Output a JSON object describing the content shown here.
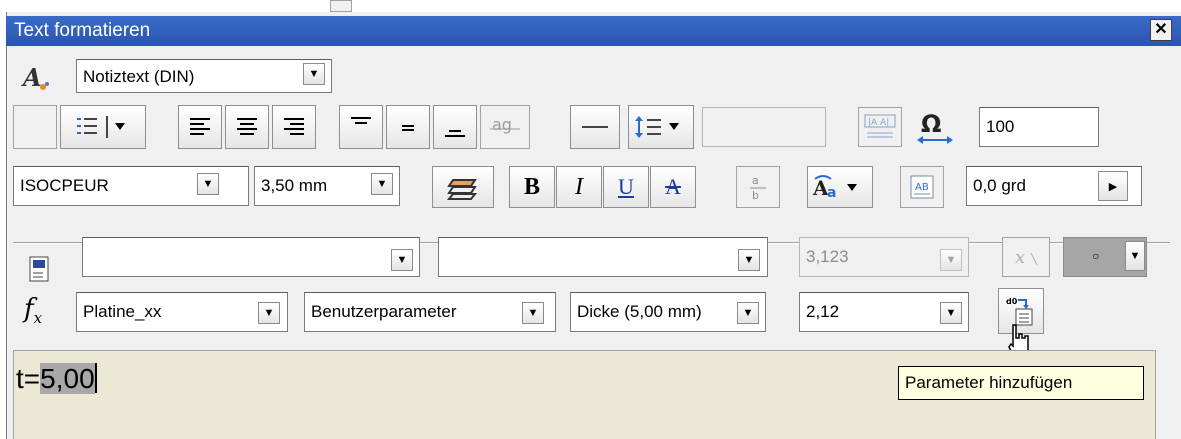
{
  "window": {
    "title": "Text formatieren",
    "close_label": "✕"
  },
  "row1": {
    "style_dropdown": {
      "value": "Notiztext (DIN)"
    }
  },
  "row2": {
    "width_scale_value": "100"
  },
  "row3": {
    "font_dropdown": {
      "value": "ISOCPEUR"
    },
    "size_dropdown": {
      "value": "3,50 mm"
    },
    "bold_label": "B",
    "italic_label": "I",
    "underline_label": "U",
    "strike_label": "A",
    "rotation_value": "0,0 grd"
  },
  "row4": {
    "precision_dropdown": {
      "value": "3,123"
    }
  },
  "row5": {
    "model_dropdown": {
      "value": "Platine_xx"
    },
    "parameter_type_dropdown": {
      "value": "Benutzerparameter"
    },
    "parameter_dropdown": {
      "value": "Dicke (5,00 mm)"
    },
    "precision_dropdown": {
      "value": "2,12"
    }
  },
  "editor": {
    "prefix": "t=",
    "selected": "5,00"
  },
  "tooltip": {
    "text": "Parameter hinzufügen"
  },
  "colors": {
    "titlebar": "#2a55b0",
    "editor_bg": "#ebe8d5",
    "tooltip_bg": "#ffffe1"
  }
}
